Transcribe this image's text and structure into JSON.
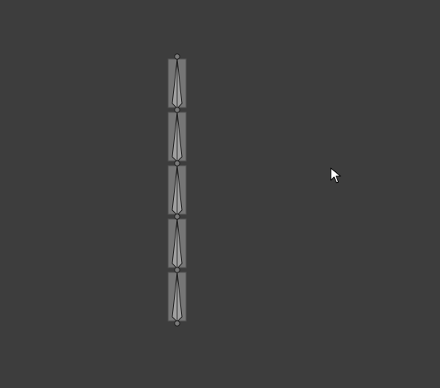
{
  "viewport": {
    "background_color": "#3d3d3d"
  },
  "armature": {
    "bone_count": 5,
    "bone_fill_color": "#8a8a8a",
    "bone_highlight_color": "#a0a0a0",
    "bone_outline_color": "#1e1e1e",
    "joint_fill_color": "#7a7a7a",
    "orientation": "vertical",
    "selection": "none"
  },
  "cursor": {
    "icon": "arrow-pointer-icon",
    "color": "#ffffff"
  }
}
